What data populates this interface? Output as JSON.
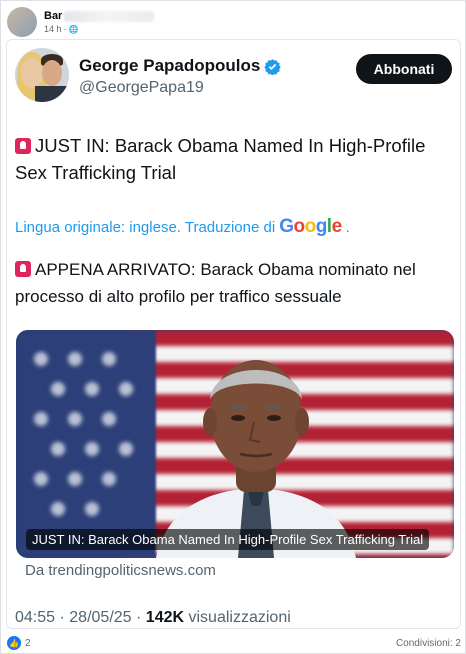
{
  "facebook_post": {
    "author_name": "Bar",
    "timestamp": "14 h",
    "audience_icon": "globe-icon",
    "reactions_count": "2",
    "shares_label": "Condivisioni: 2"
  },
  "tweet": {
    "display_name": "George Papadopoulos",
    "handle": "@GeorgePapa19",
    "follow_label": "Abbonati",
    "verified_icon": "verified-badge-icon",
    "text_original_emoji": "siren-emoji",
    "text_original": "JUST IN: Barack Obama Named In High-Profile Sex Trafficking Trial",
    "translation_prefix": "Lingua originale: inglese. Traduzione di",
    "translation_brand": "Google",
    "translation_suffix": ".",
    "text_translated": "APPENA ARRIVATO: Barack Obama nominato nel processo di alto profilo per traffico sessuale",
    "media_caption": "JUST IN: Barack Obama Named In High-Profile Sex Trafficking Trial",
    "source_text": "Da trendingpoliticsnews.com",
    "time": "04:55",
    "date": "28/05/25",
    "views_count": "142K",
    "views_label": "visualizzazioni"
  },
  "colors": {
    "link_blue": "#1d9bf0",
    "follow_bg": "#0f1419",
    "fb_blue": "#1877f2"
  }
}
